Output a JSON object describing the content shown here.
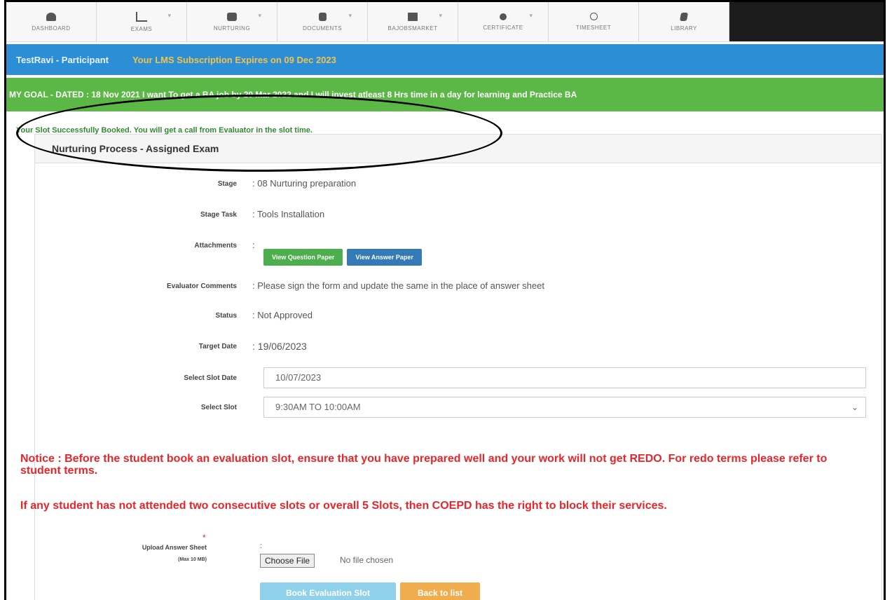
{
  "nav": [
    {
      "label": "DASHBOARD",
      "icon": "dashboard-icon"
    },
    {
      "label": "EXAMS",
      "icon": "bar-chart-icon"
    },
    {
      "label": "NURTURING",
      "icon": "users-icon"
    },
    {
      "label": "DOCUMENTS",
      "icon": "document-icon"
    },
    {
      "label": "BAJOBSMARKET",
      "icon": "list-icon"
    },
    {
      "label": "CERTIFICATE",
      "icon": "certificate-icon"
    },
    {
      "label": "TIMESHEET",
      "icon": "clock-icon"
    },
    {
      "label": "LIBRARY",
      "icon": "book-icon"
    }
  ],
  "header": {
    "participant": "TestRavi - Participant",
    "subscription": "Your LMS Subscription Expires on 09 Dec 2023"
  },
  "goal": "MY GOAL - DATED : 18 Nov 2021 I want To get a BA job by 20 Mar 2022 and I will invest atleast 8 Hrs time in a day for learning and Practice BA",
  "success_message": "Your Slot Successfully Booked. You will get a call from Evaluator in the slot time.",
  "panel": {
    "title": "Nurturing Process - Assigned Exam",
    "fields": {
      "stage_label": "Stage",
      "stage_value": ": 08 Nurturing preparation",
      "task_label": "Stage Task",
      "task_value": ": Tools Installation",
      "attach_label": "Attachments",
      "attach_colon": ":",
      "view_question": "View Question Paper",
      "view_answer": "View Answer Paper",
      "comments_label": "Evaluator Comments",
      "comments_value": ": Please sign the form and update the same in the place of answer sheet",
      "status_label": "Status",
      "status_value": ": Not Approved",
      "target_label": "Target Date",
      "target_value": ": 19/06/2023",
      "slot_date_label": "Select Slot Date",
      "slot_date_value": "10/07/2023",
      "slot_label": "Select Slot",
      "slot_value": "9:30AM TO 10:00AM"
    },
    "notice1": "Notice : Before the student book an evaluation slot, ensure that you have prepared well and your work will not get REDO. For redo terms please refer to student terms.",
    "notice2": "If any student has not attended two consecutive slots or overall 5 Slots, then COEPD has the right to block their services.",
    "upload_label": "Upload Answer Sheet",
    "upload_max": "(Max 10 MB)",
    "upload_required": "*",
    "upload_colon": ":",
    "choose_file": "Choose File",
    "no_file": "No file chosen",
    "book_button": "Book Evaluation Slot",
    "back_button": "Back to list"
  },
  "colors": {
    "blue_bar": "#2c8fd6",
    "green_bar": "#5cb846",
    "notice_red": "#e8252b",
    "book_button": "#8fd0ea",
    "back_button": "#f0ad4e"
  }
}
